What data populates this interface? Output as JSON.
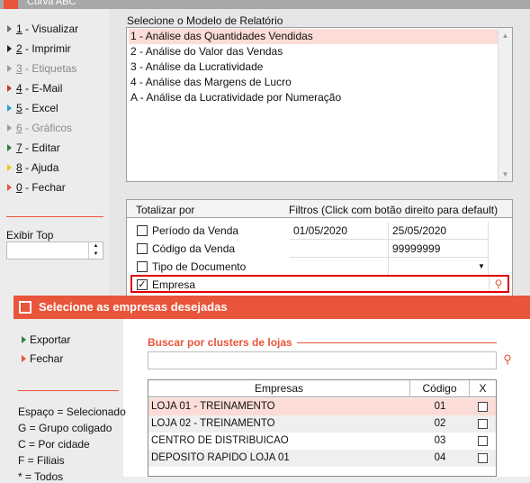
{
  "window": {
    "title": "Curva ABC"
  },
  "sidebar": {
    "items": [
      {
        "num": "1",
        "label": " - Visualizar",
        "color": "#6e6e6e",
        "disabled": false
      },
      {
        "num": "2",
        "label": " - Imprimir",
        "color": "#222222",
        "disabled": false
      },
      {
        "num": "3",
        "label": " - Etiquetas",
        "color": "#9a9a9a",
        "disabled": true
      },
      {
        "num": "4",
        "label": " - E-Mail",
        "color": "#c0392b",
        "disabled": false
      },
      {
        "num": "5",
        "label": " - Excel",
        "color": "#2f9ed8",
        "disabled": false
      },
      {
        "num": "6",
        "label": " - Gráficos",
        "color": "#9a9a9a",
        "disabled": true
      },
      {
        "num": "7",
        "label": " - Editar",
        "color": "#2e7d32",
        "disabled": false
      },
      {
        "num": "8",
        "label": " - Ajuda",
        "color": "#f0c419",
        "disabled": false
      },
      {
        "num": "0",
        "label": " - Fechar",
        "color": "#e8553a",
        "disabled": false
      }
    ],
    "exibir_top_label": "Exibir Top",
    "exibir_top_value": ""
  },
  "models": {
    "label": "Selecione o Modelo de Relatório",
    "items": [
      "1 - Análise das Quantidades Vendidas",
      "2 - Análise do Valor das Vendas",
      "3 - Análise da Lucratividade",
      "4 - Análise das Margens de Lucro",
      "A - Análise da Lucratividade por Numeração"
    ],
    "selected_index": 0
  },
  "totals": {
    "header_left": "Totalizar por",
    "header_right": "Filtros (Click com botão direito para default)",
    "rows": [
      {
        "label": "Período da Venda",
        "checked": false,
        "from": "01/05/2020",
        "to": "25/05/2020"
      },
      {
        "label": "Código da Venda",
        "checked": false,
        "from": "",
        "to": "99999999"
      },
      {
        "label": "Tipo de Documento",
        "checked": false,
        "from": "",
        "to": ""
      },
      {
        "label": "Empresa",
        "checked": true,
        "from": "",
        "to": ""
      }
    ]
  },
  "dialog": {
    "title": "Selecione as empresas desejadas",
    "actions": [
      {
        "label": "Exportar",
        "accel": "E"
      },
      {
        "label": "Fechar",
        "accel": ""
      }
    ],
    "legend": [
      "Espaço = Selecionado",
      "G = Grupo coligado",
      "C = Por cidade",
      "F = Filiais",
      "* = Todos"
    ],
    "cluster_search_label": "Buscar por clusters de lojas",
    "cluster_search_value": "",
    "table": {
      "headers": [
        "Empresas",
        "Código",
        "X"
      ],
      "rows": [
        {
          "name": "LOJA 01 - TREINAMENTO",
          "code": "01",
          "checked": false
        },
        {
          "name": "LOJA 02 - TREINAMENTO",
          "code": "02",
          "checked": false
        },
        {
          "name": "CENTRO DE DISTRIBUICAO",
          "code": "03",
          "checked": false
        },
        {
          "name": "DEPOSITO RAPIDO LOJA 01",
          "code": "04",
          "checked": false
        }
      ]
    }
  },
  "colors": {
    "accent": "#e8553a",
    "highlight": "#fbdcd6",
    "focus_border": "#e00000"
  }
}
